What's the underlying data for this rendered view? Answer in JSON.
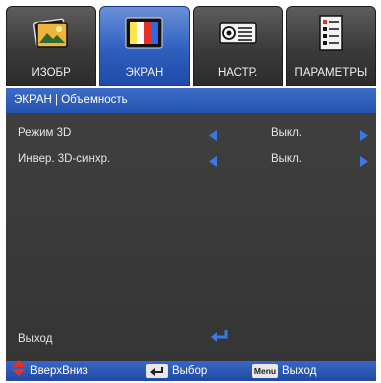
{
  "tabs": [
    {
      "label": "ИЗОБР",
      "icon": "image-icon",
      "active": false
    },
    {
      "label": "ЭКРАН",
      "icon": "display-icon",
      "active": true
    },
    {
      "label": "НАСТР.",
      "icon": "projector-icon",
      "active": false
    },
    {
      "label": "ПАРАМЕТРЫ",
      "icon": "checklist-icon",
      "active": false
    }
  ],
  "header": {
    "title": "ЭКРАН | Объемность"
  },
  "settings": [
    {
      "name": "Режим 3D",
      "value": "Выкл."
    },
    {
      "name": "Инвер. 3D-синхр.",
      "value": "Выкл."
    }
  ],
  "exit": {
    "label": "Выход"
  },
  "footer": {
    "updown": "ВверхВниз",
    "select": "Выбор",
    "menu_key": "Menu",
    "exit": "Выход"
  },
  "colors": {
    "accent": "#2f5fbf",
    "panel": "#3a3a3a",
    "arrow": "#3b78e7",
    "updown_icon": "#e0322b"
  }
}
